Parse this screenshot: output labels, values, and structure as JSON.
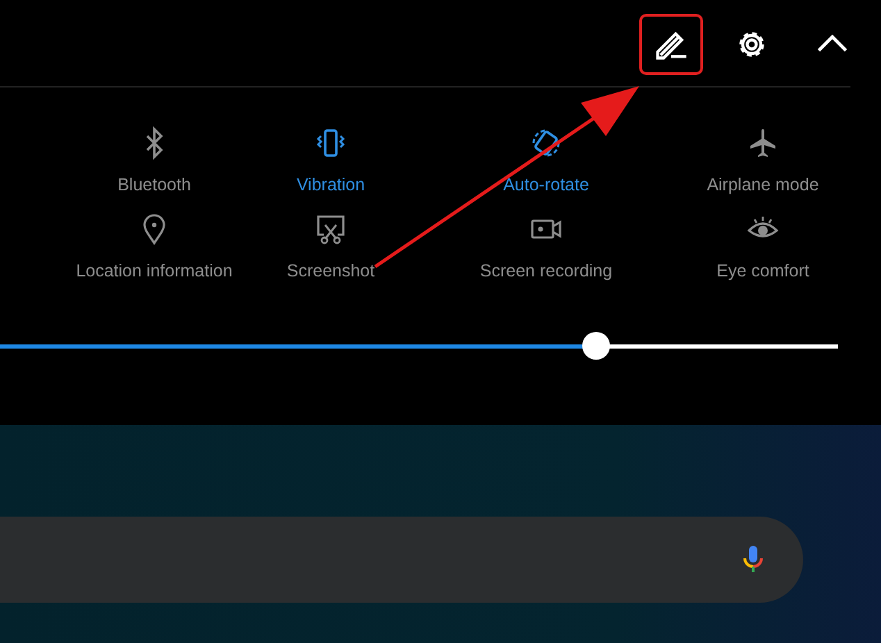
{
  "top_bar": {
    "buttons": [
      {
        "kind": "edit",
        "highlighted": true
      },
      {
        "kind": "settings",
        "highlighted": false
      },
      {
        "kind": "collapse",
        "highlighted": false
      }
    ]
  },
  "tiles": [
    {
      "kind": "bluetooth",
      "label": "Bluetooth",
      "active": false
    },
    {
      "kind": "vibration",
      "label": "Vibration",
      "active": true
    },
    {
      "kind": "rotate",
      "label": "Auto-rotate",
      "active": true
    },
    {
      "kind": "airplane",
      "label": "Airplane mode",
      "active": false
    },
    {
      "kind": "location",
      "label": "Location information",
      "active": false
    },
    {
      "kind": "screenshot",
      "label": "Screenshot",
      "active": false
    },
    {
      "kind": "record",
      "label": "Screen recording",
      "active": false
    },
    {
      "kind": "eye",
      "label": "Eye comfort",
      "active": false
    }
  ],
  "brightness": {
    "level": 0.7
  },
  "search_bar": {
    "mic": true
  }
}
